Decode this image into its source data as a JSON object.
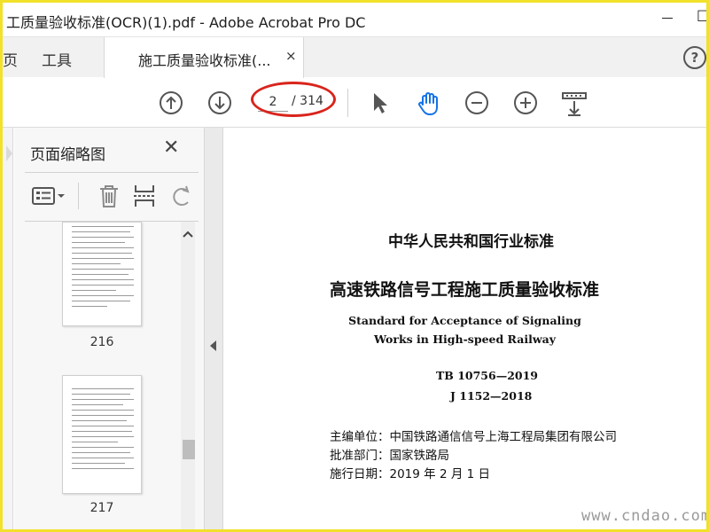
{
  "window": {
    "title": "工质量验收标准(OCR)(1).pdf - Adobe Acrobat Pro DC",
    "minimize": "—",
    "restore": "□"
  },
  "tabs": {
    "home_partial": "页",
    "tools": "工具",
    "document": "施工质量验收标准(...",
    "close": "×",
    "help": "?"
  },
  "toolbar": {
    "prev_page": "prev-page-icon",
    "next_page": "next-page-icon",
    "current_page": "2",
    "total_pages": "/ 314",
    "select_tool": "cursor-icon",
    "hand_tool": "hand-icon",
    "zoom_out": "−",
    "zoom_in": "+",
    "hand_active_color": "#1473e6",
    "annotation_color": "#d9241c"
  },
  "panel": {
    "title": "页面缩略图",
    "close": "✕",
    "tools": [
      "thumbnail-options-icon",
      "delete-page-icon",
      "insert-page-icon",
      "rotate-icon"
    ],
    "thumbnails": [
      {
        "label": "216"
      },
      {
        "label": "217"
      }
    ]
  },
  "document": {
    "line1": "中华人民共和国行业标准",
    "line2": "高速铁路信号工程施工质量验收标准",
    "en1": "Standard for Acceptance of Signaling",
    "en2": "Works in High-speed Railway",
    "code1": "TB 10756—2019",
    "code2": "J 1152—2018",
    "info1": "主编单位：中国铁路通信信号上海工程局集团有限公司",
    "info2": "批准部门：国家铁路局",
    "info3": "施行日期：2019 年 2 月 1 日"
  },
  "watermark": "www.cndao.com"
}
